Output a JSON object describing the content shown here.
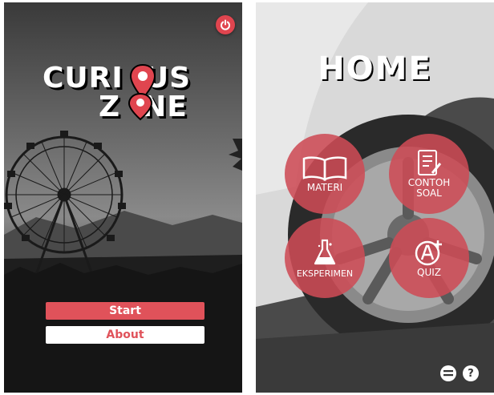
{
  "splash": {
    "logo_line1": "CURI  US",
    "logo_line2": "Z  NE",
    "start_label": "Start",
    "about_label": "About",
    "accent": "#e0525a",
    "icons": [
      "power-icon",
      "location-pin-icon"
    ]
  },
  "home": {
    "title": "HOME",
    "menu": [
      {
        "label": "MATERI",
        "icon": "book-icon"
      },
      {
        "label": "CONTOH\nSOAL",
        "icon": "checklist-icon"
      },
      {
        "label": "EKSPERIMEN",
        "icon": "flask-icon"
      },
      {
        "label": "QUIZ",
        "icon": "a-plus-grade-icon"
      }
    ],
    "circle_color": "#cd4b55",
    "help_label": "?",
    "icons": [
      "menu-icon",
      "help-icon"
    ]
  }
}
